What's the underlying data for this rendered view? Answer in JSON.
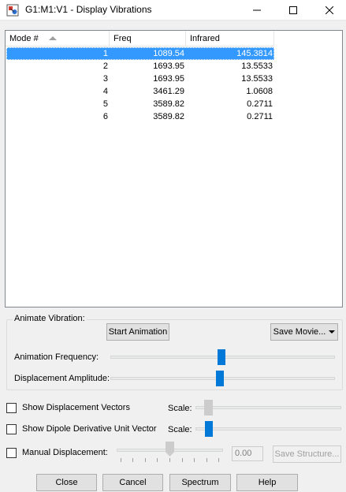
{
  "window": {
    "title": "G1:M1:V1 - Display Vibrations"
  },
  "table": {
    "headers": [
      "Mode #",
      "Freq",
      "Infrared"
    ],
    "rows": [
      {
        "mode": "1",
        "freq": "1089.54",
        "ir": "145.3814"
      },
      {
        "mode": "2",
        "freq": "1693.95",
        "ir": "13.5533"
      },
      {
        "mode": "3",
        "freq": "1693.95",
        "ir": "13.5533"
      },
      {
        "mode": "4",
        "freq": "3461.29",
        "ir": "1.0608"
      },
      {
        "mode": "5",
        "freq": "3589.82",
        "ir": "0.2711"
      },
      {
        "mode": "6",
        "freq": "3589.82",
        "ir": "0.2711"
      }
    ]
  },
  "animate": {
    "group_label": "Animate Vibration:",
    "start_label": "Start Animation",
    "save_movie_label": "Save Movie...",
    "frequency_label": "Animation Frequency:",
    "amplitude_label": "Displacement Amplitude:"
  },
  "options": {
    "show_vectors_label": "Show Displacement Vectors",
    "show_dipole_label": "Show Dipole Derivative Unit Vector",
    "scale_label": "Scale:",
    "manual_label": "Manual Displacement:",
    "manual_value": "0.00",
    "save_structure_label": "Save Structure..."
  },
  "buttons": {
    "close": "Close",
    "cancel": "Cancel",
    "spectrum": "Spectrum",
    "help": "Help"
  },
  "colors": {
    "selection": "#3399ff",
    "slider_thumb": "#0078d7"
  }
}
